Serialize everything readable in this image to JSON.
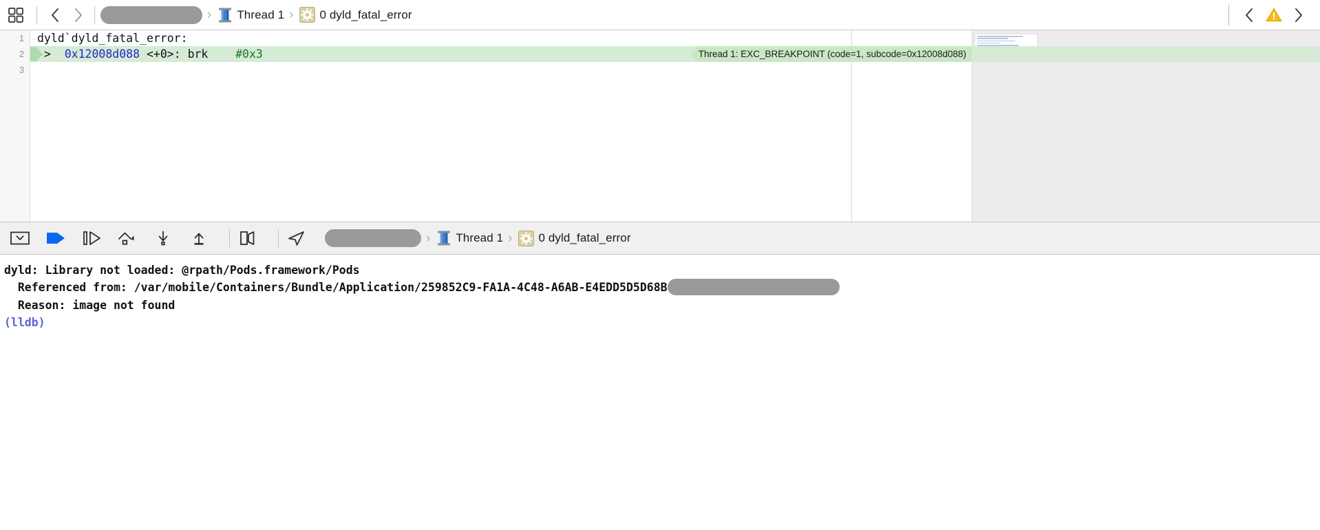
{
  "jumpbar": {
    "grid_icon": "grid-layout-icon",
    "back_icon": "chevron-left-icon",
    "forward_icon": "chevron-right-icon",
    "redacted_project_pill": "",
    "thread_icon": "thread-spool-icon",
    "thread_label": "Thread 1",
    "frame_icon": "gear-badge-icon",
    "frame_label": "0 dyld_fatal_error",
    "separator": "›",
    "issue_prev_icon": "chevron-left-icon",
    "issue_warning_icon": "warning-triangle-icon",
    "issue_next_icon": "chevron-right-icon"
  },
  "editor": {
    "lines": [
      {
        "number": "1",
        "highlighted": false,
        "pc": false,
        "segments": [
          {
            "text": "dyld`dyld_fatal_error:",
            "cls": ""
          }
        ]
      },
      {
        "number": "2",
        "highlighted": true,
        "pc": true,
        "segments": [
          {
            "text": "->  ",
            "cls": ""
          },
          {
            "text": "0x12008d088",
            "cls": "tok-addr"
          },
          {
            "text": " <+0>: brk    ",
            "cls": ""
          },
          {
            "text": "#0x3",
            "cls": "tok-imm"
          }
        ]
      },
      {
        "number": "3",
        "highlighted": false,
        "pc": false,
        "segments": []
      }
    ],
    "annotation": "Thread 1: EXC_BREAKPOINT (code=1, subcode=0x12008d088)",
    "highlight_color": "#d5ebd5",
    "annotation_color": "#c9e7c4",
    "address_color": "#2b24c6",
    "immediate_color": "#1a7a20"
  },
  "debugbar": {
    "buttons": [
      {
        "name": "hide-debug-area-button",
        "icon": "hide-debug-area-icon"
      },
      {
        "name": "continue-button",
        "icon": "continue-execution-icon"
      },
      {
        "name": "step-over-button",
        "icon": "step-over-icon"
      },
      {
        "name": "step-into-button",
        "icon": "step-into-icon"
      },
      {
        "name": "step-out-button",
        "icon": "step-out-icon"
      },
      {
        "name": "debug-view-hierarchy-button",
        "icon": "view-panels-icon"
      },
      {
        "name": "simulate-location-button",
        "icon": "location-arrow-icon"
      }
    ],
    "continue_color": "#0a68f0",
    "redacted_process_pill": "",
    "thread_icon": "thread-spool-icon",
    "thread_label": "Thread 1",
    "frame_icon": "gear-badge-icon",
    "frame_label": "0 dyld_fatal_error",
    "separator": "›"
  },
  "console": {
    "lines": [
      {
        "text": "dyld: Library not loaded: @rpath/Pods.framework/Pods",
        "style": "normal",
        "redacted": false
      },
      {
        "text": "  Referenced from: /var/mobile/Containers/Bundle/Application/259852C9-FA1A-4C48-A6AB-E4EDD5D5D68B",
        "style": "normal",
        "redacted": true
      },
      {
        "text": "  Reason: image not found",
        "style": "normal",
        "redacted": false
      },
      {
        "text": "(lldb)",
        "style": "prompt",
        "redacted": false
      }
    ],
    "prompt_color": "#5b61d6"
  }
}
